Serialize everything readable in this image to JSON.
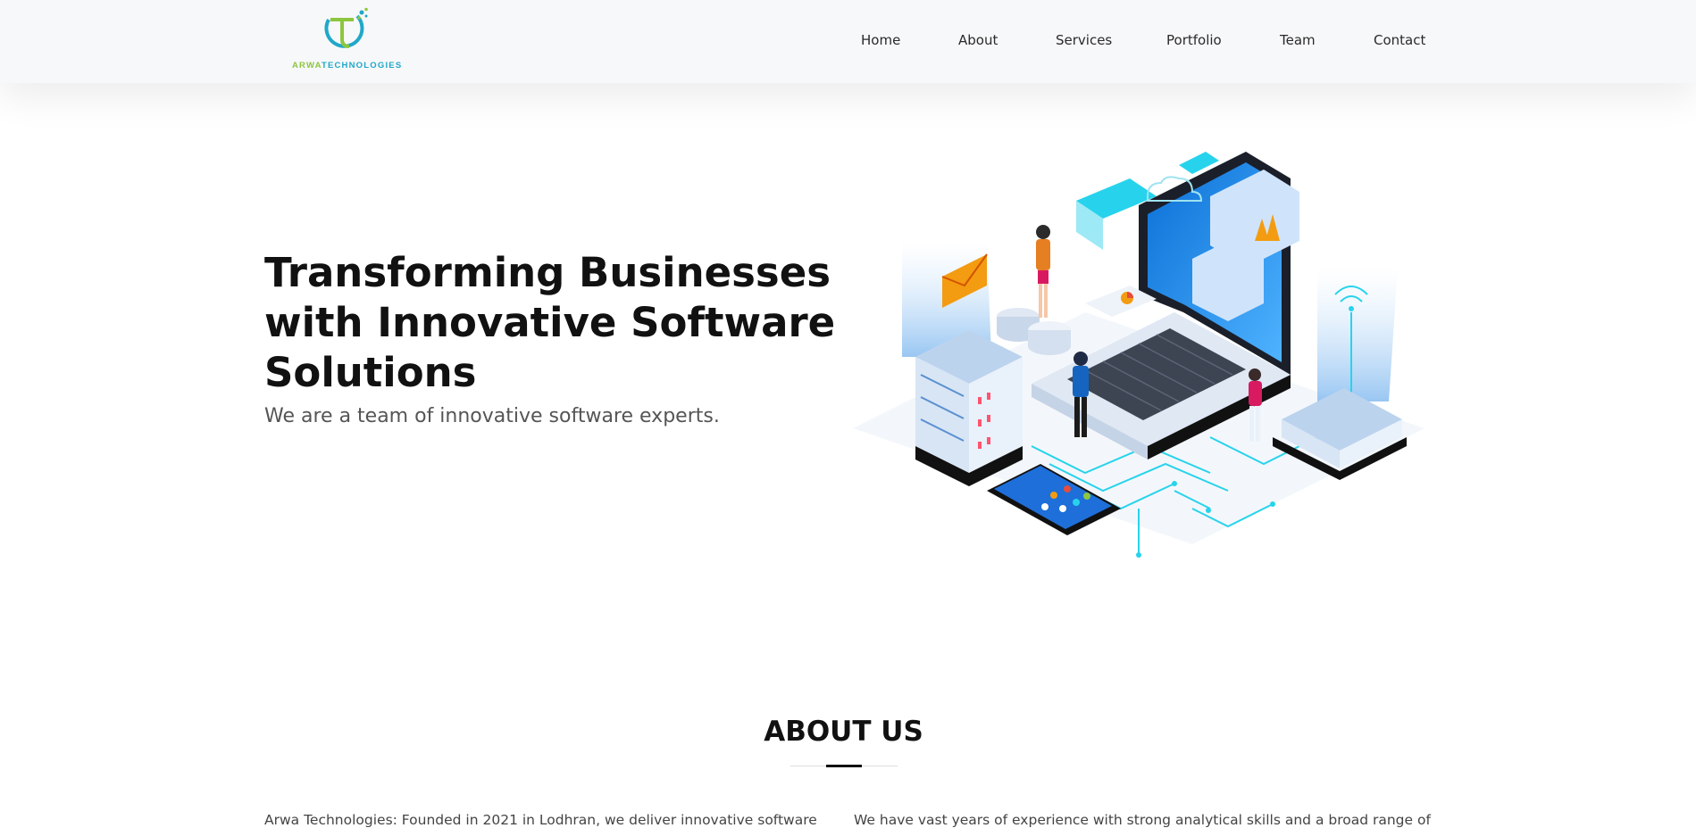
{
  "header": {
    "logo": {
      "prefix": "ARWA",
      "suffix": "TECHNOLOGIES",
      "icon": "arwa-logo-icon"
    },
    "nav": [
      {
        "label": "Home"
      },
      {
        "label": "About"
      },
      {
        "label": "Services"
      },
      {
        "label": "Portfolio"
      },
      {
        "label": "Team"
      },
      {
        "label": "Contact"
      }
    ]
  },
  "hero": {
    "title_lines": [
      "Transforming Businesses",
      "with Innovative Software",
      "Solutions"
    ],
    "subtitle": "We are a team of innovative software experts.",
    "illustration": "isometric-laptop-servers-illustration"
  },
  "about": {
    "title": "ABOUT US",
    "col1": "Arwa Technologies: Founded in 2021 in Lodhran, we deliver innovative software",
    "col2": "We have vast years of experience with strong analytical skills and a broad range of"
  },
  "colors": {
    "brand_green": "#8dc63f",
    "brand_blue": "#1fa8c9",
    "header_bg": "#f7f8f9",
    "accent_cyan": "#27d3ec"
  }
}
